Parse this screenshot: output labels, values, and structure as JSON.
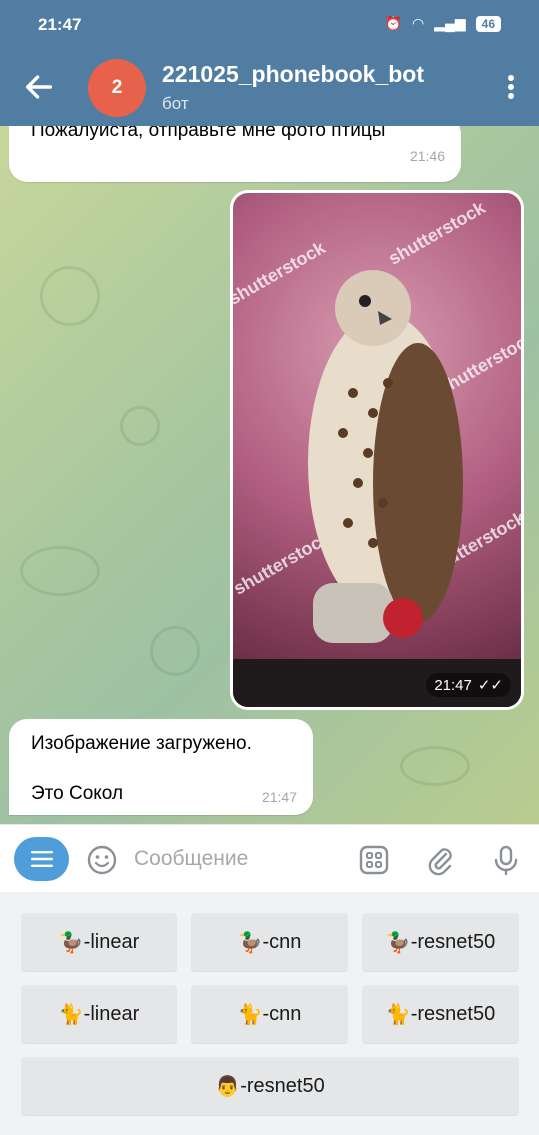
{
  "status": {
    "time": "21:47",
    "battery": "46"
  },
  "header": {
    "avatar_letter": "2",
    "title": "221025_phonebook_bot",
    "subtitle": "бот"
  },
  "messages": [
    {
      "text": "Пожалуйста, отправьте мне фото птицы",
      "time": "21:46"
    },
    {
      "type": "photo",
      "time": "21:47",
      "watermark": "shutterstock"
    },
    {
      "line1": "Изображение загружено.",
      "line2": "Это Сокол",
      "time": "21:47"
    }
  ],
  "input": {
    "placeholder": "Сообщение"
  },
  "keyboard": {
    "row1": [
      {
        "emoji": "🦆",
        "label": "-linear"
      },
      {
        "emoji": "🦆",
        "label": "-cnn"
      },
      {
        "emoji": "🦆",
        "label": "-resnet50"
      }
    ],
    "row2": [
      {
        "emoji": "🐈",
        "label": "-linear"
      },
      {
        "emoji": "🐈",
        "label": "-cnn"
      },
      {
        "emoji": "🐈",
        "label": "-resnet50"
      }
    ],
    "row3": [
      {
        "emoji": "👨",
        "label": "-resnet50"
      }
    ]
  },
  "colors": {
    "header": "#517da2",
    "accent": "#4f9edb",
    "avatar": "#e8624b"
  }
}
